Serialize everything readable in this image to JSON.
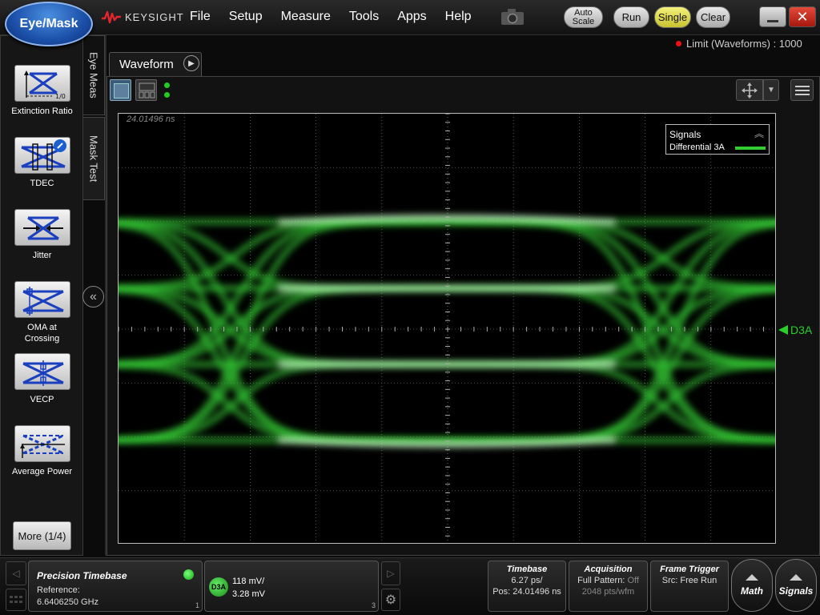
{
  "app_button": "Eye/Mask",
  "brand": "KEYSIGHT",
  "menus": [
    "File",
    "Setup",
    "Measure",
    "Tools",
    "Apps",
    "Help"
  ],
  "toolbar": {
    "autoscale_line1": "Auto",
    "autoscale_line2": "Scale",
    "run": "Run",
    "single": "Single",
    "clear": "Clear",
    "close": "✕"
  },
  "limit_status": "Limit (Waveforms) : 1000",
  "left_panel": {
    "items": [
      {
        "label": "Extinction Ratio",
        "icon": "extinction-ratio-icon"
      },
      {
        "label": "TDEC",
        "icon": "tdec-icon"
      },
      {
        "label": "Jitter",
        "icon": "jitter-icon"
      },
      {
        "label": "OMA at Crossing",
        "icon": "oma-crossing-icon"
      },
      {
        "label": "VECP",
        "icon": "vecp-icon"
      },
      {
        "label": "Average Power",
        "icon": "average-power-icon"
      }
    ],
    "more": "More (1/4)",
    "tabs": [
      "Eye Meas",
      "Mask Test"
    ],
    "icon_text_1_0": "1/0"
  },
  "waveform": {
    "tab_label": "Waveform",
    "time_label": "24.01496 ns",
    "legend_title": "Signals",
    "legend_signal": "Differential 3A",
    "marker_label": "D3A",
    "trace_color": "#33cc33"
  },
  "bottom": {
    "timebase_panel": {
      "title": "Precision Timebase",
      "ref_label": "Reference:",
      "freq": "6.6406250 GHz",
      "index": "1"
    },
    "channel_panel": {
      "badge": "D3A",
      "scale": "118 mV/",
      "offset": "3.28 mV",
      "index": "3"
    },
    "timebase": {
      "title": "Timebase",
      "scale": "6.27 ps/",
      "pos": "Pos: 24.01496 ns"
    },
    "acquisition": {
      "title": "Acquisition",
      "pattern_label": "Full Pattern:",
      "pattern_value": "Off",
      "pts": "2048 pts/wfm"
    },
    "trigger": {
      "title": "Frame Trigger",
      "src": "Src: Free Run"
    },
    "math": "Math",
    "signals": "Signals"
  }
}
